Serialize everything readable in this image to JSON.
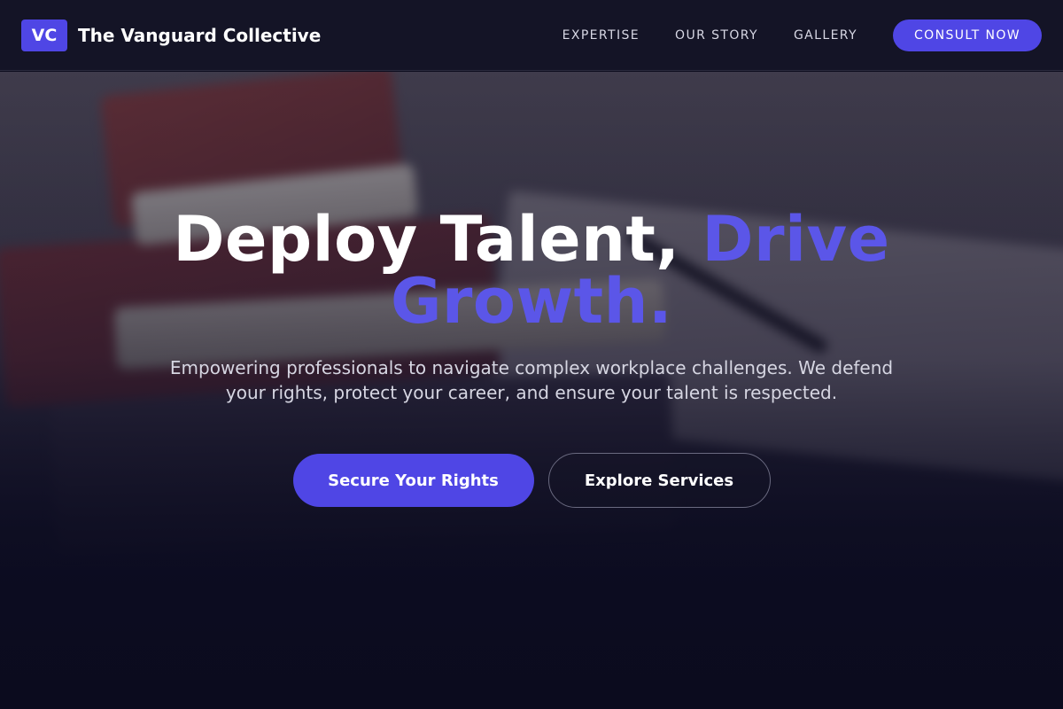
{
  "brand": {
    "logo_text": "VC",
    "name": "The Vanguard Collective"
  },
  "nav": {
    "items": [
      {
        "label": "EXPERTISE"
      },
      {
        "label": "OUR STORY"
      },
      {
        "label": "GALLERY"
      }
    ],
    "cta_label": "CONSULT NOW"
  },
  "hero": {
    "title_main": "Deploy Talent,",
    "title_accent": "Drive Growth.",
    "subtitle": "Empowering professionals to navigate complex workplace challenges. We defend your rights, protect your career, and ensure your talent is respected.",
    "primary_button": "Secure Your Rights",
    "secondary_button": "Explore Services"
  },
  "colors": {
    "accent": "#4f46e5",
    "accent_text": "#5b56e8",
    "header_bg": "#141426",
    "page_bg": "#0d0d1f"
  }
}
